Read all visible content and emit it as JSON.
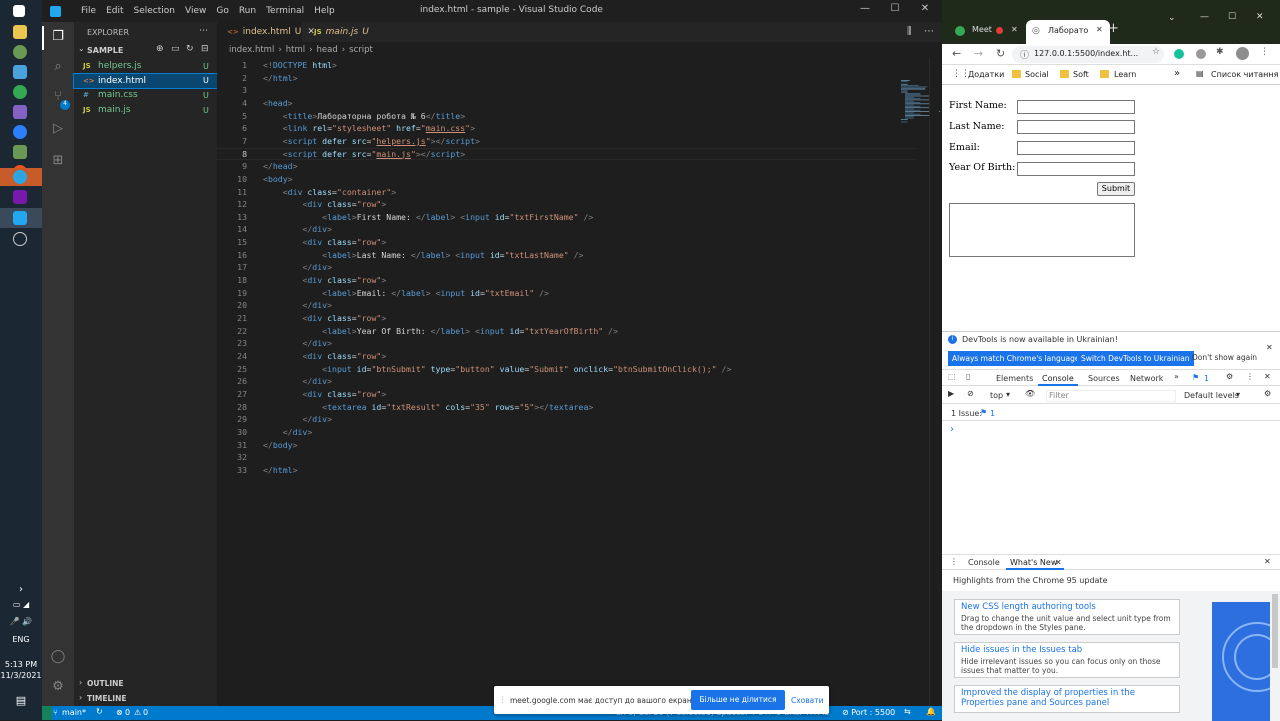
{
  "taskbar": {
    "time": "5:13 PM",
    "date": "11/3/2021",
    "lang": "ENG"
  },
  "vscode": {
    "menu": [
      "File",
      "Edit",
      "Selection",
      "View",
      "Go",
      "Run",
      "Terminal",
      "Help"
    ],
    "title": "index.html - sample - Visual Studio Code",
    "explorer": {
      "title": "EXPLORER",
      "folder": "SAMPLE",
      "files": [
        {
          "icon": "JS",
          "name": "helpers.js",
          "status": "U"
        },
        {
          "icon": "<>",
          "name": "index.html",
          "status": "U"
        },
        {
          "icon": "#",
          "name": "main.css",
          "status": "U"
        },
        {
          "icon": "JS",
          "name": "main.js",
          "status": "U"
        }
      ],
      "outline": "OUTLINE",
      "timeline": "TIMELINE"
    },
    "tabs": [
      {
        "name": "index.html",
        "status": "U"
      },
      {
        "name": "main.js",
        "status": "U"
      }
    ],
    "breadcrumb": [
      "index.html",
      "html",
      "head",
      "script"
    ],
    "code_lines": [
      {
        "n": "1",
        "segs": [
          [
            "br",
            "<!"
          ],
          [
            "tg",
            "DOCTYPE "
          ],
          [
            "at",
            "html"
          ],
          [
            "br",
            ">"
          ]
        ]
      },
      {
        "n": "2",
        "segs": [
          [
            "br",
            "</"
          ],
          [
            "tg",
            "html"
          ],
          [
            "br",
            ">"
          ]
        ]
      },
      {
        "n": "3",
        "segs": []
      },
      {
        "n": "4",
        "segs": [
          [
            "br",
            "<"
          ],
          [
            "tg",
            "head"
          ],
          [
            "br",
            ">"
          ]
        ]
      },
      {
        "n": "5",
        "segs": [
          [
            "tx",
            "    "
          ],
          [
            "br",
            "<"
          ],
          [
            "tg",
            "title"
          ],
          [
            "br",
            ">"
          ],
          [
            "tx",
            "Лабораторна робота № 6"
          ],
          [
            "br",
            "</"
          ],
          [
            "tg",
            "title"
          ],
          [
            "br",
            ">"
          ]
        ]
      },
      {
        "n": "6",
        "segs": [
          [
            "tx",
            "    "
          ],
          [
            "br",
            "<"
          ],
          [
            "tg",
            "link "
          ],
          [
            "at",
            "rel"
          ],
          [
            "tx",
            "="
          ],
          [
            "sv",
            "\"stylesheet\" "
          ],
          [
            "at",
            "href"
          ],
          [
            "tx",
            "="
          ],
          [
            "sv",
            "\""
          ],
          [
            "svu",
            "main.css"
          ],
          [
            "sv",
            "\""
          ],
          [
            "br",
            ">"
          ]
        ]
      },
      {
        "n": "7",
        "segs": [
          [
            "tx",
            "    "
          ],
          [
            "br",
            "<"
          ],
          [
            "tg",
            "script "
          ],
          [
            "at",
            "defer src"
          ],
          [
            "tx",
            "="
          ],
          [
            "sv",
            "\""
          ],
          [
            "svu",
            "helpers.js"
          ],
          [
            "sv",
            "\""
          ],
          [
            "br",
            "></"
          ],
          [
            "tg",
            "script"
          ],
          [
            "br",
            ">"
          ]
        ]
      },
      {
        "n": "8",
        "segs": [
          [
            "tx",
            "    "
          ],
          [
            "br",
            "<"
          ],
          [
            "tg",
            "script "
          ],
          [
            "at",
            "defer src"
          ],
          [
            "tx",
            "="
          ],
          [
            "sv",
            "\""
          ],
          [
            "svu",
            "main.js"
          ],
          [
            "sv",
            "\""
          ],
          [
            "br",
            "></"
          ],
          [
            "tg",
            "script"
          ],
          [
            "br",
            ">"
          ]
        ]
      },
      {
        "n": "9",
        "segs": [
          [
            "br",
            "</"
          ],
          [
            "tg",
            "head"
          ],
          [
            "br",
            ">"
          ]
        ]
      },
      {
        "n": "10",
        "segs": [
          [
            "br",
            "<"
          ],
          [
            "tg",
            "body"
          ],
          [
            "br",
            ">"
          ]
        ]
      },
      {
        "n": "11",
        "segs": [
          [
            "tx",
            "    "
          ],
          [
            "br",
            "<"
          ],
          [
            "tg",
            "div "
          ],
          [
            "at",
            "class"
          ],
          [
            "tx",
            "="
          ],
          [
            "sv",
            "\"container\""
          ],
          [
            "br",
            ">"
          ]
        ]
      },
      {
        "n": "12",
        "segs": [
          [
            "tx",
            "        "
          ],
          [
            "br",
            "<"
          ],
          [
            "tg",
            "div "
          ],
          [
            "at",
            "class"
          ],
          [
            "tx",
            "="
          ],
          [
            "sv",
            "\"row\""
          ],
          [
            "br",
            ">"
          ]
        ]
      },
      {
        "n": "13",
        "segs": [
          [
            "tx",
            "            "
          ],
          [
            "br",
            "<"
          ],
          [
            "tg",
            "label"
          ],
          [
            "br",
            ">"
          ],
          [
            "tx",
            "First Name: "
          ],
          [
            "br",
            "</"
          ],
          [
            "tg",
            "label"
          ],
          [
            "br",
            "> <"
          ],
          [
            "tg",
            "input "
          ],
          [
            "at",
            "id"
          ],
          [
            "tx",
            "="
          ],
          [
            "sv",
            "\"txtFirstName\" "
          ],
          [
            "br",
            "/>"
          ]
        ]
      },
      {
        "n": "14",
        "segs": [
          [
            "tx",
            "        "
          ],
          [
            "br",
            "</"
          ],
          [
            "tg",
            "div"
          ],
          [
            "br",
            ">"
          ]
        ]
      },
      {
        "n": "15",
        "segs": [
          [
            "tx",
            "        "
          ],
          [
            "br",
            "<"
          ],
          [
            "tg",
            "div "
          ],
          [
            "at",
            "class"
          ],
          [
            "tx",
            "="
          ],
          [
            "sv",
            "\"row\""
          ],
          [
            "br",
            ">"
          ]
        ]
      },
      {
        "n": "16",
        "segs": [
          [
            "tx",
            "            "
          ],
          [
            "br",
            "<"
          ],
          [
            "tg",
            "label"
          ],
          [
            "br",
            ">"
          ],
          [
            "tx",
            "Last Name: "
          ],
          [
            "br",
            "</"
          ],
          [
            "tg",
            "label"
          ],
          [
            "br",
            "> <"
          ],
          [
            "tg",
            "input "
          ],
          [
            "at",
            "id"
          ],
          [
            "tx",
            "="
          ],
          [
            "sv",
            "\"txtLastName\" "
          ],
          [
            "br",
            "/>"
          ]
        ]
      },
      {
        "n": "17",
        "segs": [
          [
            "tx",
            "        "
          ],
          [
            "br",
            "</"
          ],
          [
            "tg",
            "div"
          ],
          [
            "br",
            ">"
          ]
        ]
      },
      {
        "n": "18",
        "segs": [
          [
            "tx",
            "        "
          ],
          [
            "br",
            "<"
          ],
          [
            "tg",
            "div "
          ],
          [
            "at",
            "class"
          ],
          [
            "tx",
            "="
          ],
          [
            "sv",
            "\"row\""
          ],
          [
            "br",
            ">"
          ]
        ]
      },
      {
        "n": "19",
        "segs": [
          [
            "tx",
            "            "
          ],
          [
            "br",
            "<"
          ],
          [
            "tg",
            "label"
          ],
          [
            "br",
            ">"
          ],
          [
            "tx",
            "Email: "
          ],
          [
            "br",
            "</"
          ],
          [
            "tg",
            "label"
          ],
          [
            "br",
            "> <"
          ],
          [
            "tg",
            "input "
          ],
          [
            "at",
            "id"
          ],
          [
            "tx",
            "="
          ],
          [
            "sv",
            "\"txtEmail\" "
          ],
          [
            "br",
            "/>"
          ]
        ]
      },
      {
        "n": "20",
        "segs": [
          [
            "tx",
            "        "
          ],
          [
            "br",
            "</"
          ],
          [
            "tg",
            "div"
          ],
          [
            "br",
            ">"
          ]
        ]
      },
      {
        "n": "21",
        "segs": [
          [
            "tx",
            "        "
          ],
          [
            "br",
            "<"
          ],
          [
            "tg",
            "div "
          ],
          [
            "at",
            "class"
          ],
          [
            "tx",
            "="
          ],
          [
            "sv",
            "\"row\""
          ],
          [
            "br",
            ">"
          ]
        ]
      },
      {
        "n": "22",
        "segs": [
          [
            "tx",
            "            "
          ],
          [
            "br",
            "<"
          ],
          [
            "tg",
            "label"
          ],
          [
            "br",
            ">"
          ],
          [
            "tx",
            "Year Of Birth: "
          ],
          [
            "br",
            "</"
          ],
          [
            "tg",
            "label"
          ],
          [
            "br",
            "> <"
          ],
          [
            "tg",
            "input "
          ],
          [
            "at",
            "id"
          ],
          [
            "tx",
            "="
          ],
          [
            "sv",
            "\"txtYearOfBirth\" "
          ],
          [
            "br",
            "/>"
          ]
        ]
      },
      {
        "n": "23",
        "segs": [
          [
            "tx",
            "        "
          ],
          [
            "br",
            "</"
          ],
          [
            "tg",
            "div"
          ],
          [
            "br",
            ">"
          ]
        ]
      },
      {
        "n": "24",
        "segs": [
          [
            "tx",
            "        "
          ],
          [
            "br",
            "<"
          ],
          [
            "tg",
            "div "
          ],
          [
            "at",
            "class"
          ],
          [
            "tx",
            "="
          ],
          [
            "sv",
            "\"row\""
          ],
          [
            "br",
            ">"
          ]
        ]
      },
      {
        "n": "25",
        "segs": [
          [
            "tx",
            "            "
          ],
          [
            "br",
            "<"
          ],
          [
            "tg",
            "input "
          ],
          [
            "at",
            "id"
          ],
          [
            "tx",
            "="
          ],
          [
            "sv",
            "\"btnSubmit\" "
          ],
          [
            "at",
            "type"
          ],
          [
            "tx",
            "="
          ],
          [
            "sv",
            "\"button\" "
          ],
          [
            "at",
            "value"
          ],
          [
            "tx",
            "="
          ],
          [
            "sv",
            "\"Submit\" "
          ],
          [
            "at",
            "onclick"
          ],
          [
            "tx",
            "="
          ],
          [
            "sv",
            "\"btnSubmitOnClick();\" "
          ],
          [
            "br",
            "/>"
          ]
        ]
      },
      {
        "n": "26",
        "segs": [
          [
            "tx",
            "        "
          ],
          [
            "br",
            "</"
          ],
          [
            "tg",
            "div"
          ],
          [
            "br",
            ">"
          ]
        ]
      },
      {
        "n": "27",
        "segs": [
          [
            "tx",
            "        "
          ],
          [
            "br",
            "<"
          ],
          [
            "tg",
            "div "
          ],
          [
            "at",
            "class"
          ],
          [
            "tx",
            "="
          ],
          [
            "sv",
            "\"row\""
          ],
          [
            "br",
            ">"
          ]
        ]
      },
      {
        "n": "28",
        "segs": [
          [
            "tx",
            "            "
          ],
          [
            "br",
            "<"
          ],
          [
            "tg",
            "textarea "
          ],
          [
            "at",
            "id"
          ],
          [
            "tx",
            "="
          ],
          [
            "sv",
            "\"txtResult\" "
          ],
          [
            "at",
            "cols"
          ],
          [
            "tx",
            "="
          ],
          [
            "sv",
            "\"35\" "
          ],
          [
            "at",
            "rows"
          ],
          [
            "tx",
            "="
          ],
          [
            "sv",
            "\"5\""
          ],
          [
            "br",
            "></"
          ],
          [
            "tg",
            "textarea"
          ],
          [
            "br",
            ">"
          ]
        ]
      },
      {
        "n": "29",
        "segs": [
          [
            "tx",
            "        "
          ],
          [
            "br",
            "</"
          ],
          [
            "tg",
            "div"
          ],
          [
            "br",
            ">"
          ]
        ]
      },
      {
        "n": "30",
        "segs": [
          [
            "tx",
            "    "
          ],
          [
            "br",
            "</"
          ],
          [
            "tg",
            "div"
          ],
          [
            "br",
            ">"
          ]
        ]
      },
      {
        "n": "31",
        "segs": [
          [
            "br",
            "</"
          ],
          [
            "tg",
            "body"
          ],
          [
            "br",
            ">"
          ]
        ]
      },
      {
        "n": "32",
        "segs": []
      },
      {
        "n": "33",
        "segs": [
          [
            "br",
            "</"
          ],
          [
            "tg",
            "html"
          ],
          [
            "br",
            ">"
          ]
        ]
      }
    ],
    "status": {
      "branch": "main*",
      "errors": "0",
      "warnings": "0",
      "port": "Port : 5500",
      "middle": "Ln 8, Col 29 (7 selected)   Spaces: 4   UTF-8   CRLF   HTML"
    }
  },
  "chrome": {
    "tabs": [
      "Meet",
      "Лаборато"
    ],
    "url": "127.0.0.1:5500/index.ht...",
    "bookmarks": [
      "Додатки",
      "Social",
      "Soft",
      "Learn"
    ],
    "reading_list": "Список читання",
    "form": {
      "first_name": "First Name:",
      "last_name": "Last Name:",
      "email": "Email:",
      "year": "Year Of Birth:",
      "submit": "Submit"
    },
    "devtools": {
      "banner": "DevTools is now available in Ukrainian!",
      "btn_match": "Always match Chrome's language",
      "btn_switch": "Switch DevTools to Ukrainian",
      "btn_dont": "Don't show again",
      "panels": [
        "Elements",
        "Console",
        "Sources",
        "Network"
      ],
      "issue_badge": "1",
      "context": "top",
      "filter_placeholder": "Filter",
      "levels": "Default levels",
      "issues": "1 Issue:",
      "issues_count": "1",
      "prompt": "›",
      "drawer_tabs": [
        "Console",
        "What's New"
      ],
      "highlights": "Highlights from the Chrome 95 update",
      "cards": [
        {
          "title": "New CSS length authoring tools",
          "desc": "Drag to change the unit value and select unit type from the dropdown in the Styles pane."
        },
        {
          "title": "Hide issues in the Issues tab",
          "desc": "Hide irrelevant issues so you can focus only on those issues that matter to you."
        },
        {
          "title": "Improved the display of properties in the Properties pane and Sources panel",
          "desc": ""
        }
      ]
    }
  },
  "toast": {
    "text": "meet.google.com має доступ до вашого екрана.",
    "stop": "Більше не ділитися",
    "hide": "Сховати"
  }
}
